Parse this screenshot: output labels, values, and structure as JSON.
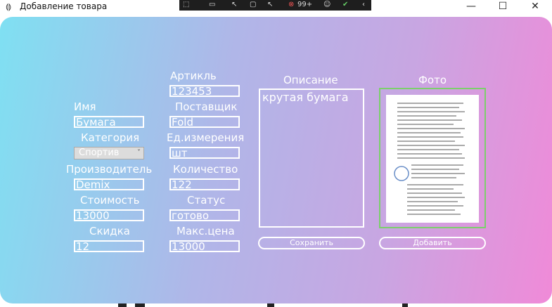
{
  "window": {
    "title": "Добавление товара",
    "app_icon": "gear-dots-icon",
    "minimize": "—",
    "maximize": "☐",
    "close": "✕"
  },
  "devbar": {
    "badge": "99+",
    "icons": [
      "select-element-icon",
      "camera-icon",
      "cursor-icon",
      "frame-icon",
      "track-icon",
      "badge-icon",
      "accessibility-icon",
      "check-icon",
      "collapse-icon"
    ]
  },
  "form": {
    "name_label": "Имя",
    "name_value": "Бумага",
    "category_label": "Категория",
    "category_value": "Спортив",
    "manufacturer_label": "Производитель",
    "manufacturer_value": "Demix",
    "cost_label": "Стоимость",
    "cost_value": "13000",
    "discount_label": "Скидка",
    "discount_value": "12",
    "article_label": "Артикль",
    "article_value": "123453",
    "supplier_label": "Поставщик",
    "supplier_value": "Fold",
    "unit_label": "Ед.измерения",
    "unit_value": "шт",
    "quantity_label": "Количество",
    "quantity_value": "122",
    "status_label": "Статус",
    "status_value": "готово",
    "maxprice_label": "Макс.цена",
    "maxprice_value": "13000",
    "description_label": "Описание",
    "description_value": "крутая бумага",
    "photo_label": "Фото",
    "save_button": "Сохранить",
    "add_button": "Добавить"
  }
}
